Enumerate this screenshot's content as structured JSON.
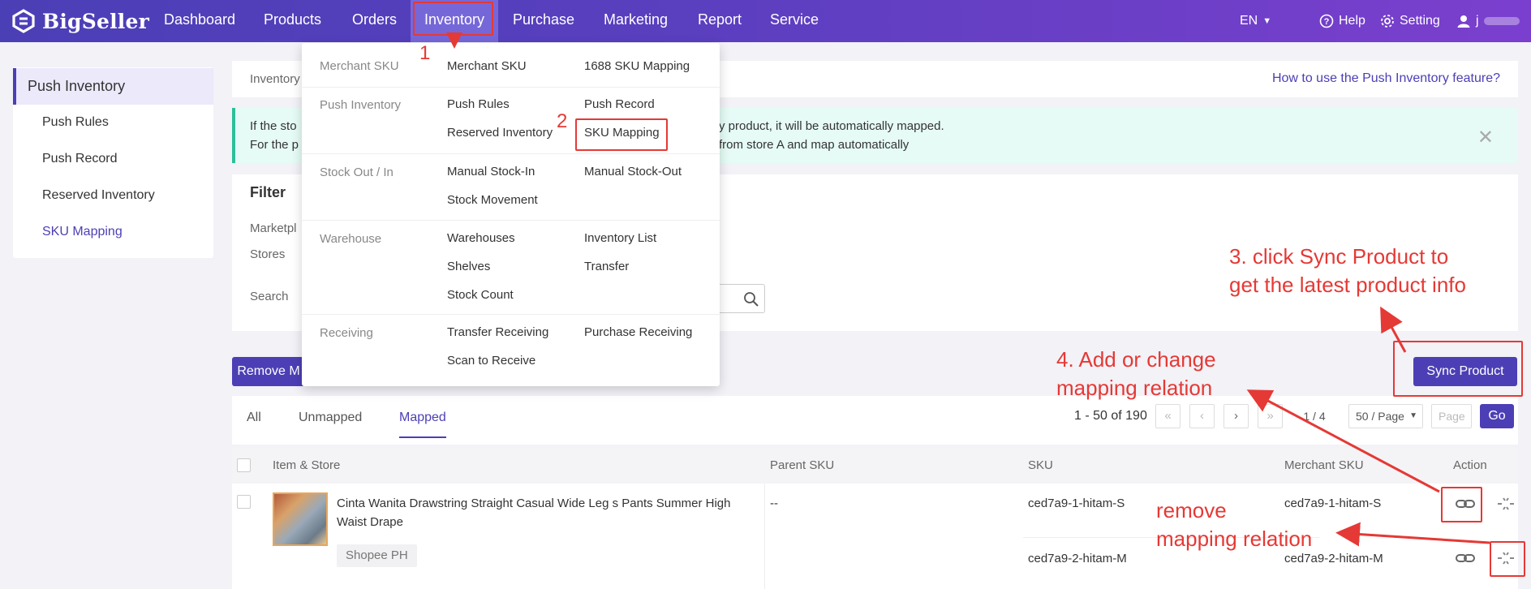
{
  "brand": {
    "name": "BigSeller",
    "accent": "#4c3fb5",
    "annotation_color": "#e53935"
  },
  "nav": {
    "items": [
      "Dashboard",
      "Products",
      "Orders",
      "Inventory",
      "Purchase",
      "Marketing",
      "Report",
      "Service"
    ],
    "active": "Inventory",
    "language": "EN",
    "help": "Help",
    "setting": "Setting",
    "user": "j"
  },
  "sidebar": {
    "header": "Push Inventory",
    "items": [
      "Push Rules",
      "Push Record",
      "Reserved Inventory",
      "SKU Mapping"
    ],
    "active": "SKU Mapping"
  },
  "breadcrumb": "Inventory",
  "help_link": "How to use the Push Inventory feature?",
  "notice": {
    "line1_prefix": "If the sto",
    "line1_suffix": "y product, it will be automatically mapped.",
    "line2_prefix": "For the p",
    "line2_suffix": "from store A and map automatically",
    "close": "✕"
  },
  "filter": {
    "title": "Filter",
    "labels": [
      "Marketpl",
      "Stores",
      "Search"
    ]
  },
  "buttons": {
    "remove": "Remove M",
    "sync": "Sync Product",
    "go": "Go"
  },
  "tabs": [
    "All",
    "Unmapped",
    "Mapped"
  ],
  "active_tab": "Mapped",
  "pagination": {
    "summary": "1 - 50 of 190",
    "page": "1 / 4",
    "per_page": "50 / Page",
    "page_placeholder": "Page"
  },
  "table": {
    "headers": [
      "Item & Store",
      "Parent SKU",
      "SKU",
      "Merchant SKU",
      "Action"
    ],
    "row": {
      "title": "Cinta Wanita Drawstring Straight Casual Wide Leg s Pants Summer High Waist Drape",
      "store": "Shopee PH",
      "parent_sku": "--",
      "variants": [
        {
          "sku": "ced7a9-1-hitam-S",
          "merchant_sku": "ced7a9-1-hitam-S"
        },
        {
          "sku": "ced7a9-2-hitam-M",
          "merchant_sku": "ced7a9-2-hitam-M"
        }
      ]
    }
  },
  "dropdown": {
    "groups": [
      {
        "name": "Merchant SKU",
        "items": [
          "Merchant SKU",
          "1688 SKU Mapping"
        ]
      },
      {
        "name": "Push Inventory",
        "items": [
          "Push Rules",
          "Push Record",
          "Reserved Inventory",
          "SKU Mapping"
        ]
      },
      {
        "name": "Stock Out / In",
        "items": [
          "Manual Stock-In",
          "Manual Stock-Out",
          "Stock Movement"
        ]
      },
      {
        "name": "Warehouse",
        "items": [
          "Warehouses",
          "Inventory List",
          "Shelves",
          "Transfer",
          "Stock Count"
        ]
      },
      {
        "name": "Receiving",
        "items": [
          "Transfer Receiving",
          "Purchase Receiving",
          "Scan to Receive"
        ]
      }
    ]
  },
  "annotations": {
    "step1": "1",
    "step2": "2",
    "step3_line1": "3. click Sync Product to",
    "step3_line2": "get the latest product info",
    "step4_line1": "4. Add or change",
    "step4_line2": "mapping relation",
    "remove_line1": "remove",
    "remove_line2": "mapping relation"
  }
}
